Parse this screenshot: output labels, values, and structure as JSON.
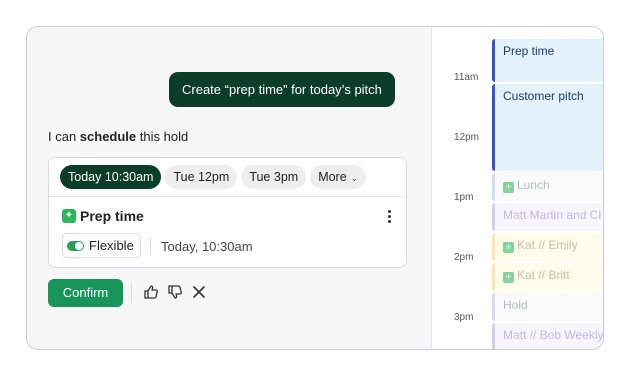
{
  "chat": {
    "user_message": "Create “prep time” for today’s pitch",
    "reply_prefix": "I can ",
    "reply_bold": "schedule",
    "reply_suffix": " this hold"
  },
  "card": {
    "time_options": [
      {
        "label": "Today 10:30am",
        "selected": true
      },
      {
        "label": "Tue 12pm",
        "selected": false
      },
      {
        "label": "Tue 3pm",
        "selected": false
      }
    ],
    "more_label": "More",
    "event_title": "Prep time",
    "event_icon": "sparkle-icon",
    "flexible_label": "Flexible",
    "flexible_on": true,
    "when": "Today, 10:30am"
  },
  "actions": {
    "confirm_label": "Confirm",
    "icons": [
      "thumbs-up-icon",
      "thumbs-down-icon",
      "close-icon"
    ]
  },
  "calendar": {
    "time_labels": [
      "11am",
      "12pm",
      "1pm",
      "2pm",
      "3pm"
    ],
    "events": [
      {
        "title": "Prep time",
        "style": "blue",
        "icon": false
      },
      {
        "title": "Customer pitch",
        "style": "blue",
        "icon": false
      },
      {
        "title": "Lunch",
        "style": "faint",
        "icon": true
      },
      {
        "title": "Matt Martin and Cl",
        "style": "purple",
        "icon": false
      },
      {
        "title": "Kat // Emily",
        "style": "yellow",
        "icon": true
      },
      {
        "title": "Kat // Britt",
        "style": "yellow",
        "icon": true
      },
      {
        "title": "Hold",
        "style": "faint",
        "icon": false
      },
      {
        "title": "Matt // Bob Weekly",
        "style": "purple",
        "icon": false
      }
    ]
  },
  "colors": {
    "accent_dark": "#0c3d2a",
    "confirm_green": "#17955a",
    "event_blue": "#3553cf"
  }
}
